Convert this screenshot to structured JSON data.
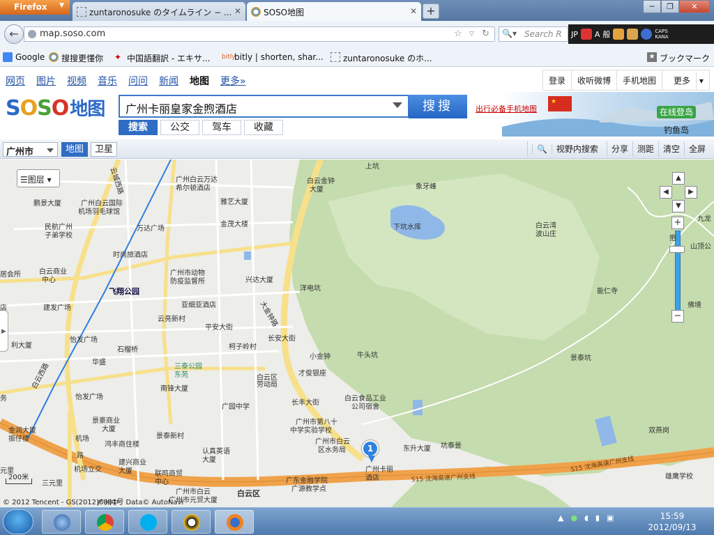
{
  "browser": {
    "menu_label": "Firefox",
    "tabs": [
      {
        "title": "zuntaronosuke のタイムライン − ..."
      },
      {
        "title": "SOSO地图"
      }
    ],
    "url": "map.soso.com",
    "search_placeholder": "Search R",
    "addon_labels": {
      "jp": "JP",
      "a": "A",
      "kanji": "般",
      "caps": "CAPS",
      "kana": "KANA"
    },
    "bookmarks": [
      {
        "label": "Google"
      },
      {
        "label": "搜搜更懂你"
      },
      {
        "label": "中国語翻訳 - エキサ..."
      },
      {
        "label": "bitly | shorten, shar..."
      },
      {
        "label": "zuntaronosuke のホ..."
      }
    ],
    "bookmarks_menu": "ブックマーク"
  },
  "soso": {
    "nav": [
      "网页",
      "图片",
      "视频",
      "音乐",
      "问问",
      "新闻",
      "地图",
      "更多»"
    ],
    "nav_current": 6,
    "top_links": [
      "登录",
      "收听微博",
      "手机地图",
      "更多"
    ],
    "logo": {
      "s1": "S",
      "o": "O",
      "s2": "S",
      "o2": "O",
      "dt": "地图"
    },
    "search_value": "广州卡丽皇家金煦酒店",
    "search_button": "搜搜",
    "search_tabs": [
      "搜索",
      "公交",
      "驾车",
      "收藏"
    ],
    "promo": "出行必备手机地图",
    "banner_button": "在线登岛",
    "banner_label": "钓鱼岛"
  },
  "toolbar": {
    "city": "广州市",
    "map_types": [
      "地图",
      "卫星"
    ],
    "tools": [
      "视野内搜索",
      "分享",
      "测距",
      "清空",
      "全屏"
    ]
  },
  "map": {
    "layer_button": "图层",
    "marker_number": "1",
    "scale": "200米",
    "copyright": "© 2012 Tencent - GS(2012)6001号  Data© AutoNavi",
    "labels": [
      {
        "t": "上坑"
      },
      {
        "t": "广州白云万达"
      },
      {
        "t": "希尔顿酒店"
      },
      {
        "t": "白云金钟"
      },
      {
        "t": "大厦"
      },
      {
        "t": "象牙峰"
      },
      {
        "t": "九龙"
      },
      {
        "t": "鹏景大厦"
      },
      {
        "t": "广州白云国际"
      },
      {
        "t": "机场羽毛球馆"
      },
      {
        "t": "雅艺大厦"
      },
      {
        "t": "民航广州"
      },
      {
        "t": "子弟学校"
      },
      {
        "t": "万达广场"
      },
      {
        "t": "金茂大楼"
      },
      {
        "t": "下坑水库"
      },
      {
        "t": "白云湾"
      },
      {
        "t": "波山庄"
      },
      {
        "t": "抱"
      },
      {
        "t": "山顶公"
      },
      {
        "t": "时尚旅酒店"
      },
      {
        "t": "白云商业"
      },
      {
        "t": "中心"
      },
      {
        "t": "居会所"
      },
      {
        "t": "广州市动物"
      },
      {
        "t": "防疫监督所"
      },
      {
        "t": "兴达大厦"
      },
      {
        "t": "飞翔公园"
      },
      {
        "t": "洋电坑"
      },
      {
        "t": "能仁寺"
      },
      {
        "t": "亚细亚酒店"
      },
      {
        "t": "建发广场"
      },
      {
        "t": "佛境"
      },
      {
        "t": "云亮新村"
      },
      {
        "t": "平安大街"
      },
      {
        "t": "大金钟路"
      },
      {
        "t": "长安大街"
      },
      {
        "t": "利大厦"
      },
      {
        "t": "怡发广场"
      },
      {
        "t": "柯子岭村"
      },
      {
        "t": "石榴桥"
      },
      {
        "t": "小金钟"
      },
      {
        "t": "牛头坑"
      },
      {
        "t": "景泰坑"
      },
      {
        "t": "华盛"
      },
      {
        "t": "三泰公园"
      },
      {
        "t": "东苑"
      },
      {
        "t": "才俊银座"
      },
      {
        "t": "南锋大厦"
      },
      {
        "t": "白云区"
      },
      {
        "t": "劳动局"
      },
      {
        "t": "怡发广场"
      },
      {
        "t": "白云食品工业"
      },
      {
        "t": "公司宿舍"
      },
      {
        "t": "长丰大街"
      },
      {
        "t": "广园中学"
      },
      {
        "t": "景豪商业"
      },
      {
        "t": "大厦"
      },
      {
        "t": "广州市第八十"
      },
      {
        "t": "中学实验学校"
      },
      {
        "t": "双燕岗"
      },
      {
        "t": "金润大厦"
      },
      {
        "t": "振仔楼"
      },
      {
        "t": "景泰新村"
      },
      {
        "t": "机场"
      },
      {
        "t": "路"
      },
      {
        "t": "广州市白云"
      },
      {
        "t": "区水务局"
      },
      {
        "t": "东升大厦"
      },
      {
        "t": "坑泰景"
      },
      {
        "t": "鸿丰商住楼"
      },
      {
        "t": "认真英语"
      },
      {
        "t": "大厦"
      },
      {
        "t": "建兴商业"
      },
      {
        "t": "大厦"
      },
      {
        "t": "联鸣商贸"
      },
      {
        "t": "中心"
      },
      {
        "t": "机场立交"
      },
      {
        "t": "广州卡丽"
      },
      {
        "t": "酒店"
      },
      {
        "t": "元里"
      },
      {
        "t": "三元里"
      },
      {
        "t": "广东金融学院"
      },
      {
        "t": "广源教学点"
      },
      {
        "t": "雄鹰学校"
      },
      {
        "t": "广州市白云"
      },
      {
        "t": "广州市元贸大厦"
      },
      {
        "t": "白云区"
      },
      {
        "t": "广州中"
      },
      {
        "t": "白云西路"
      },
      {
        "t": "云城西路"
      },
      {
        "t": "务"
      },
      {
        "t": "店"
      }
    ],
    "highway_label_1": "S15 沈海高速广州支线",
    "highway_label_2": "S15 沈海高速广州支线"
  },
  "taskbar": {
    "time": "15:59",
    "date": "2012/09/13"
  }
}
